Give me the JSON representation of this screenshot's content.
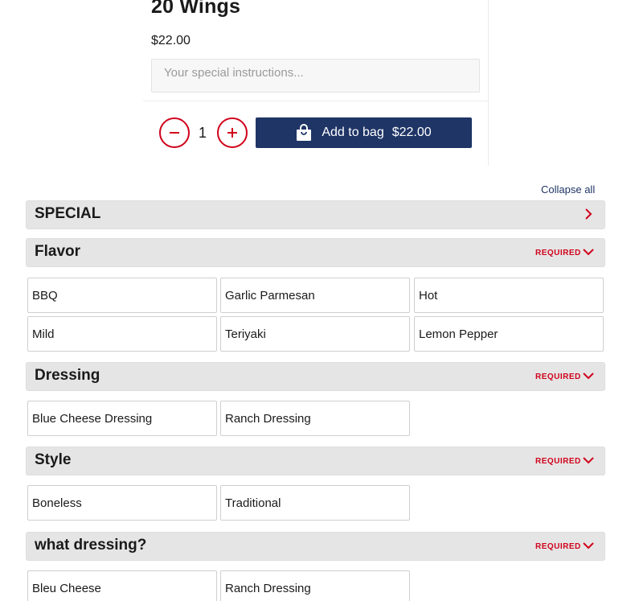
{
  "product": {
    "title": "20 Wings",
    "price": "$22.00",
    "instructions_placeholder": "Your special instructions..."
  },
  "order": {
    "quantity": "1",
    "add_label": "Add to bag",
    "add_price": "$22.00",
    "minus_icon": "minus-icon",
    "plus_icon": "plus-icon",
    "bag_icon": "shopping-bag-icon"
  },
  "collapse_all": "Collapse all",
  "colors": {
    "accent_red": "#d0021b",
    "brand_navy": "#1f3566",
    "section_bg": "#e5e5e5"
  },
  "sections": [
    {
      "title": "SPECIAL",
      "required": "",
      "chevron": "chevron-right-icon",
      "options": []
    },
    {
      "title": "Flavor",
      "required": "REQUIRED",
      "chevron": "chevron-down-icon",
      "options": [
        "BBQ",
        "Garlic Parmesan",
        "Hot",
        "Mild",
        "Teriyaki",
        "Lemon Pepper"
      ]
    },
    {
      "title": "Dressing",
      "required": "REQUIRED",
      "chevron": "chevron-down-icon",
      "options": [
        "Blue Cheese Dressing",
        "Ranch Dressing"
      ]
    },
    {
      "title": "Style",
      "required": "REQUIRED",
      "chevron": "chevron-down-icon",
      "options": [
        "Boneless",
        "Traditional"
      ]
    },
    {
      "title": "what dressing?",
      "required": "REQUIRED",
      "chevron": "chevron-down-icon",
      "options": [
        "Bleu Cheese",
        "Ranch Dressing"
      ]
    }
  ]
}
